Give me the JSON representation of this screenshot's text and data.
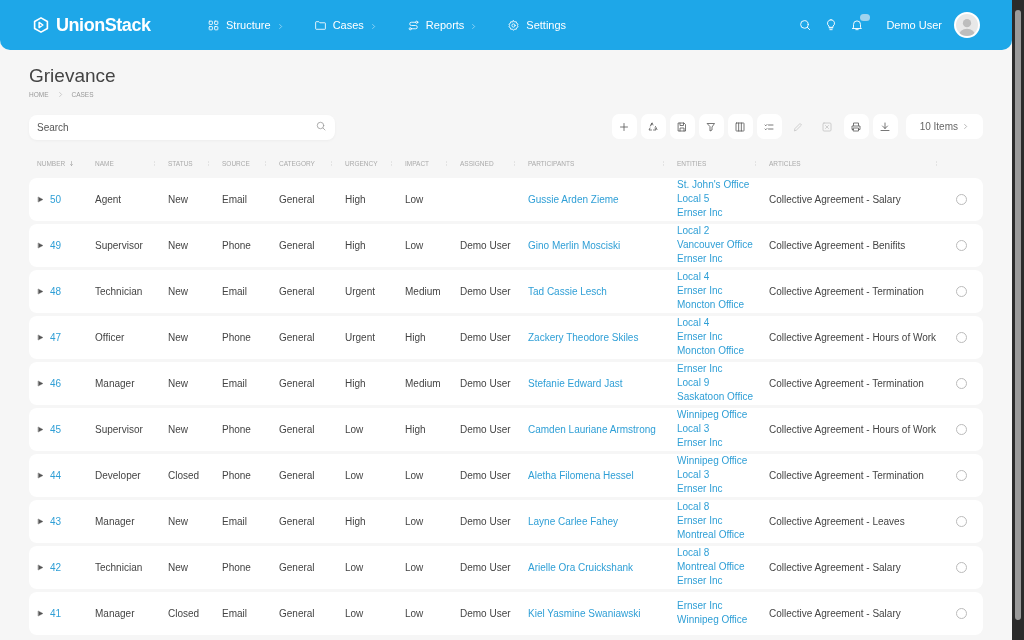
{
  "brand": "UnionStack",
  "nav": [
    {
      "label": "Structure",
      "kind": "grid",
      "submenu": true
    },
    {
      "label": "Cases",
      "kind": "folder",
      "submenu": true
    },
    {
      "label": "Reports",
      "kind": "route",
      "submenu": true
    },
    {
      "label": "Settings",
      "kind": "gear",
      "submenu": false
    }
  ],
  "user": {
    "name": "Demo User",
    "has_notifications": true
  },
  "page": {
    "title": "Grievance",
    "breadcrumbs": [
      "HOME",
      "CASES"
    ]
  },
  "search": {
    "placeholder": "Search"
  },
  "toolbar": [
    {
      "kind": "add",
      "disabled": false
    },
    {
      "kind": "recycle",
      "disabled": false
    },
    {
      "kind": "save",
      "disabled": false
    },
    {
      "kind": "filter",
      "disabled": false
    },
    {
      "kind": "columns",
      "disabled": false
    },
    {
      "kind": "list",
      "disabled": false
    },
    {
      "kind": "edit",
      "disabled": true
    },
    {
      "kind": "delete",
      "disabled": true
    },
    {
      "kind": "print",
      "disabled": false
    },
    {
      "kind": "download",
      "disabled": false
    }
  ],
  "items_button": "10 Items",
  "table": {
    "columns": [
      {
        "label": "NUMBER",
        "sorted": true
      },
      {
        "label": "NAME",
        "sorted": false
      },
      {
        "label": "STATUS",
        "sorted": false
      },
      {
        "label": "SOURCE",
        "sorted": false
      },
      {
        "label": "CATEGORY",
        "sorted": false
      },
      {
        "label": "URGENCY",
        "sorted": false
      },
      {
        "label": "IMPACT",
        "sorted": false
      },
      {
        "label": "ASSIGNED",
        "sorted": false
      },
      {
        "label": "PARTICIPANTS",
        "sorted": false
      },
      {
        "label": "ENTITIES",
        "sorted": false
      },
      {
        "label": "ARTICLES",
        "sorted": false
      }
    ],
    "rows": [
      {
        "number": "50",
        "name": "Agent",
        "status": "New",
        "source": "Email",
        "category": "General",
        "urgency": "High",
        "impact": "Low",
        "participants": "Gussie Arden Zieme",
        "entities": [
          "St. John's Office",
          "Local 5",
          "Ernser Inc"
        ],
        "articles": "Collective Agreement - Salary",
        "selected": false
      },
      {
        "number": "49",
        "name": "Supervisor",
        "status": "New",
        "source": "Phone",
        "category": "General",
        "urgency": "High",
        "impact": "Low",
        "assigned": "Demo User",
        "participants": "Gino Merlin Mosciski",
        "entities": [
          "Local 2",
          "Vancouver Office",
          "Ernser Inc"
        ],
        "articles": "Collective Agreement - Benifits",
        "selected": false
      },
      {
        "number": "48",
        "name": "Technician",
        "status": "New",
        "source": "Email",
        "category": "General",
        "urgency": "Urgent",
        "impact": "Medium",
        "assigned": "Demo User",
        "participants": "Tad Cassie Lesch",
        "entities": [
          "Local 4",
          "Ernser Inc",
          "Moncton Office"
        ],
        "articles": "Collective Agreement - Termination",
        "selected": false
      },
      {
        "number": "47",
        "name": "Officer",
        "status": "New",
        "source": "Phone",
        "category": "General",
        "urgency": "Urgent",
        "impact": "High",
        "assigned": "Demo User",
        "participants": "Zackery Theodore Skiles",
        "entities": [
          "Local 4",
          "Ernser Inc",
          "Moncton Office"
        ],
        "articles": "Collective Agreement - Hours of Work",
        "selected": false
      },
      {
        "number": "46",
        "name": "Manager",
        "status": "New",
        "source": "Email",
        "category": "General",
        "urgency": "High",
        "impact": "Medium",
        "assigned": "Demo User",
        "participants": "Stefanie Edward Jast",
        "entities": [
          "Ernser Inc",
          "Local 9",
          "Saskatoon Office"
        ],
        "articles": "Collective Agreement - Termination",
        "selected": false
      },
      {
        "number": "45",
        "name": "Supervisor",
        "status": "New",
        "source": "Phone",
        "category": "General",
        "urgency": "Low",
        "impact": "High",
        "assigned": "Demo User",
        "participants": "Camden Lauriane Armstrong",
        "entities": [
          "Winnipeg Office",
          "Local 3",
          "Ernser Inc"
        ],
        "articles": "Collective Agreement - Hours of Work",
        "selected": false
      },
      {
        "number": "44",
        "name": "Developer",
        "status": "Closed",
        "source": "Phone",
        "category": "General",
        "urgency": "Low",
        "impact": "Low",
        "assigned": "Demo User",
        "participants": "Aletha Filomena Hessel",
        "entities": [
          "Winnipeg Office",
          "Local 3",
          "Ernser Inc"
        ],
        "articles": "Collective Agreement - Termination",
        "selected": false
      },
      {
        "number": "43",
        "name": "Manager",
        "status": "New",
        "source": "Email",
        "category": "General",
        "urgency": "High",
        "impact": "Low",
        "assigned": "Demo User",
        "participants": "Layne Carlee Fahey",
        "entities": [
          "Local 8",
          "Ernser Inc",
          "Montreal Office"
        ],
        "articles": "Collective Agreement - Leaves",
        "selected": false
      },
      {
        "number": "42",
        "name": "Technician",
        "status": "New",
        "source": "Phone",
        "category": "General",
        "urgency": "Low",
        "impact": "Low",
        "assigned": "Demo User",
        "participants": "Arielle Ora Cruickshank",
        "entities": [
          "Local 8",
          "Montreal Office",
          "Ernser Inc"
        ],
        "articles": "Collective Agreement - Salary",
        "selected": false
      },
      {
        "number": "41",
        "name": "Manager",
        "status": "Closed",
        "source": "Email",
        "category": "General",
        "urgency": "Low",
        "impact": "Low",
        "assigned": "Demo User",
        "participants": "Kiel Yasmine Swaniawski",
        "entities": [
          "Ernser Inc",
          "Winnipeg Office"
        ],
        "articles": "Collective Agreement - Salary",
        "selected": false
      }
    ]
  }
}
